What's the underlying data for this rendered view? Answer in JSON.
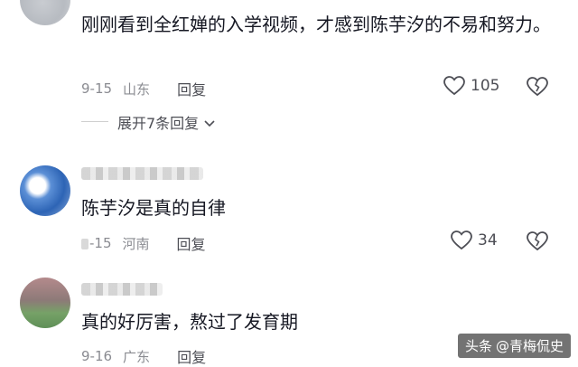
{
  "comments": [
    {
      "text": "刚刚看到全红婵的入学视频，才感到陈芋汐的不易和努力。",
      "date": "9-15",
      "location": "山东",
      "reply_label": "回复",
      "likes": "105"
    },
    {
      "text": "陈芋汐是真的自律",
      "date": "-15",
      "location": "河南",
      "reply_label": "回复",
      "likes": "34"
    },
    {
      "text": "真的好厉害，熬过了发育期",
      "date": "9-16",
      "location": "广东",
      "reply_label": "回复"
    }
  ],
  "expand_replies_label": "展开7条回复",
  "watermark": {
    "prefix": "头条",
    "handle": "@青梅侃史"
  },
  "colors": {
    "text": "#161823",
    "meta": "#8a8b91",
    "reply": "#4d4e55"
  }
}
